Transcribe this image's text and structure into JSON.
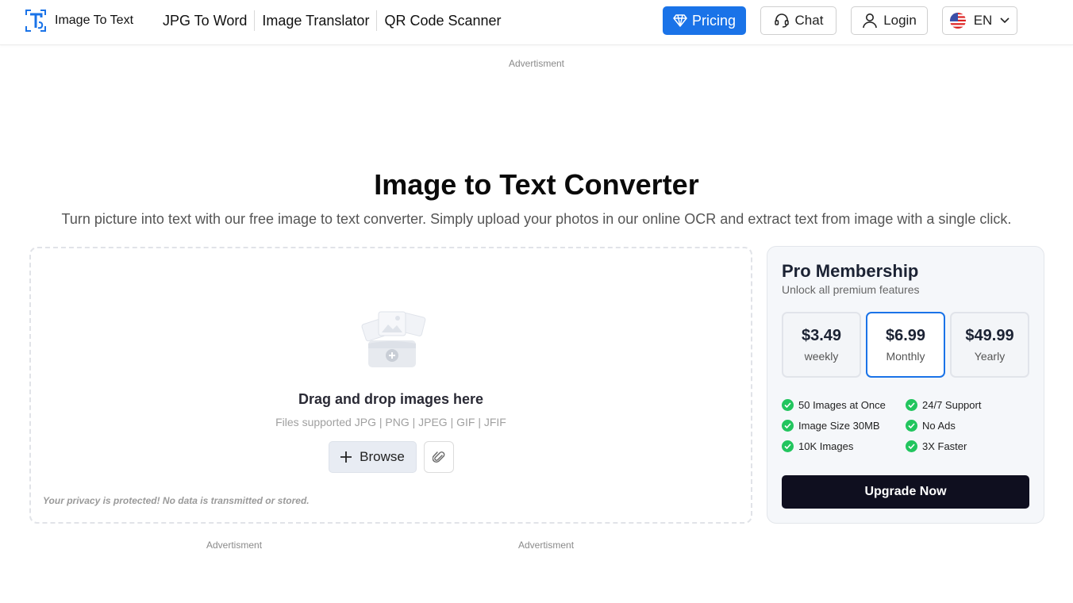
{
  "header": {
    "logo_text": "Image To Text",
    "nav": [
      "JPG To Word",
      "Image Translator",
      "QR Code Scanner"
    ],
    "pricing_label": "Pricing",
    "chat_label": "Chat",
    "login_label": "Login",
    "language_label": "EN"
  },
  "ads": {
    "top": "Advertisment",
    "bottom_left": "Advertisment",
    "bottom_center": "Advertisment"
  },
  "hero": {
    "title": "Image to Text Converter",
    "subtitle": "Turn picture into text with our free image to text converter. Simply upload your photos in our online OCR and extract text from image with a single click."
  },
  "upload": {
    "drop_text": "Drag and drop images here",
    "types_text": "Files supported JPG | PNG | JPEG | GIF | JFIF",
    "browse_label": "Browse",
    "privacy_text": "Your privacy is protected! No data is transmitted or stored."
  },
  "pro": {
    "title": "Pro Membership",
    "subtitle": "Unlock all premium features",
    "plans": [
      {
        "price": "$3.49",
        "period": "weekly"
      },
      {
        "price": "$6.99",
        "period": "Monthly"
      },
      {
        "price": "$49.99",
        "period": "Yearly"
      }
    ],
    "selected_plan": "Monthly",
    "features": [
      "50 Images at Once",
      "24/7 Support",
      "Image Size 30MB",
      "No Ads",
      "10K Images",
      "3X Faster"
    ],
    "upgrade_label": "Upgrade Now"
  },
  "colors": {
    "accent": "#1a73e8",
    "check": "#22c55e",
    "upgrade_bg": "#0f0f1f"
  }
}
